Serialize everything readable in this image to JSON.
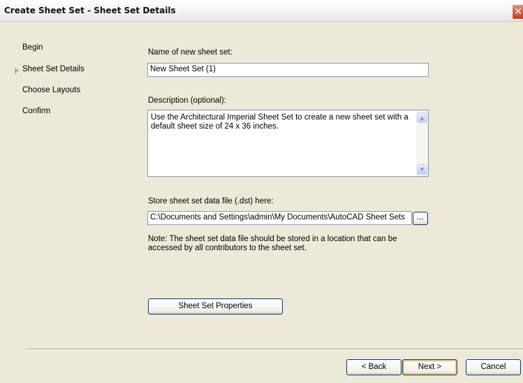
{
  "window": {
    "title": "Create Sheet Set - Sheet Set Details",
    "close_glyph": "✕"
  },
  "sidebar": {
    "items": [
      {
        "label": "Begin"
      },
      {
        "label": "Sheet Set Details",
        "current": true
      },
      {
        "label": "Choose Layouts"
      },
      {
        "label": "Confirm"
      }
    ]
  },
  "form": {
    "name_label": "Name of new sheet set:",
    "name_value": "New Sheet Set (1)",
    "description_label": "Description (optional):",
    "description_value": "Use the Architectural Imperial Sheet Set to create a new sheet set with a default sheet size of 24 x 36 inches.",
    "store_label": "Store sheet set data file (.dst) here:",
    "store_value": "C:\\Documents and Settings\\admin\\My Documents\\AutoCAD Sheet Sets",
    "browse_label": "...",
    "note": "Note: The sheet set data file should be stored in a location that can be accessed by all contributors to the sheet set.",
    "properties_label": "Sheet Set Properties"
  },
  "footer": {
    "back_label": "< Back",
    "next_label": "Next >",
    "cancel_label": "Cancel"
  },
  "icons": {
    "scroll_up": "▲",
    "scroll_down": "▼",
    "current_step": "triangle-right-icon"
  }
}
